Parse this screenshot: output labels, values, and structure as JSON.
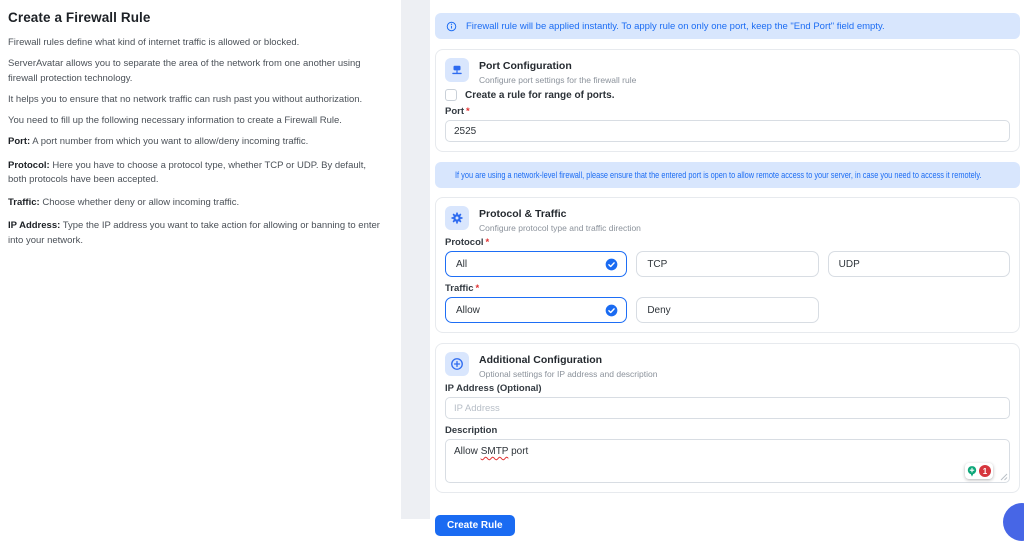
{
  "ui": {
    "required_mark": "*"
  },
  "colors": {
    "accent_blue": "#1a6bf2",
    "banner_bg": "#d8e6fd",
    "banner_text": "#1d6df3",
    "icon_tile_bg": "#d9e6fd",
    "error_red": "#e03131",
    "badge_green": "#0ca678",
    "fab_blue": "#4766e6"
  },
  "left_panel": {
    "title": "Create a Firewall Rule",
    "paragraphs": [
      "Firewall rules define what kind of internet traffic is allowed or blocked.",
      "ServerAvatar allows you to separate the area of the network from one another using firewall protection technology.",
      "It helps you to ensure that no network traffic can rush past you without authorization.",
      "You need to fill up the following necessary information to create a Firewall Rule."
    ],
    "definitions": [
      {
        "term": "Port:",
        "text": " A port number from which you want to allow/deny incoming traffic."
      },
      {
        "term": "Protocol:",
        "text": " Here you have to choose a protocol type, whether TCP or UDP. By default, both protocols have been accepted."
      },
      {
        "term": "Traffic:",
        "text": " Choose whether deny or allow incoming traffic."
      },
      {
        "term": "IP Address:",
        "text": " Type the IP address you want to take action for allowing or banning to enter into your network."
      }
    ]
  },
  "banners": {
    "instant": "Firewall rule will be applied instantly. To apply rule on only one port, keep the \"End Port\" field empty.",
    "network": "If you are using a network-level firewall, please ensure that the entered port is open to allow remote access to your server, in case you need to access it remotely."
  },
  "port_section": {
    "title": "Port Configuration",
    "subtitle": "Configure port settings for the firewall rule",
    "range_checkbox_label": "Create a rule for range of ports.",
    "port_label": "Port",
    "port_value": "2525"
  },
  "protocol_section": {
    "title": "Protocol & Traffic",
    "subtitle": "Configure protocol type and traffic direction",
    "protocol_label": "Protocol",
    "protocol_options": [
      {
        "label": "All",
        "selected": true
      },
      {
        "label": "TCP",
        "selected": false
      },
      {
        "label": "UDP",
        "selected": false
      }
    ],
    "traffic_label": "Traffic",
    "traffic_options": [
      {
        "label": "Allow",
        "selected": true
      },
      {
        "label": "Deny",
        "selected": false
      }
    ]
  },
  "additional_section": {
    "title": "Additional Configuration",
    "subtitle": "Optional settings for IP address and description",
    "ip_label": "IP Address (Optional)",
    "ip_placeholder": "IP Address",
    "description_label": "Description",
    "description_parts": {
      "before": "Allow ",
      "flagged": "SMTP",
      "after": " port"
    },
    "grammar_badge_count": "1"
  },
  "actions": {
    "create_button": "Create Rule"
  }
}
